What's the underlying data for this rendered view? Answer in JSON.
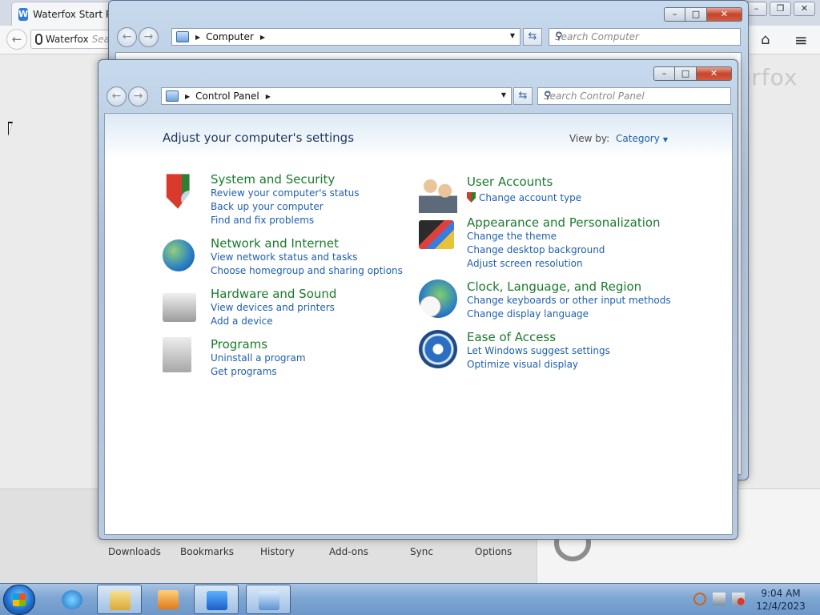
{
  "browser": {
    "tab_title": "Waterfox Start Pa",
    "tab_icon_letter": "W",
    "url_label": "Waterfox",
    "url_placeholder": "Sea",
    "watermark": "erfox",
    "footer": [
      "Downloads",
      "Bookmarks",
      "History",
      "Add-ons",
      "Sync",
      "Options"
    ]
  },
  "computer_window": {
    "breadcrumb": "Computer",
    "search_placeholder": "Search Computer"
  },
  "control_panel": {
    "breadcrumb": "Control Panel",
    "search_placeholder": "Search Control Panel",
    "heading": "Adjust your computer's settings",
    "view_by_label": "View by:",
    "view_by_value": "Category",
    "categories": [
      {
        "title": "System and Security",
        "icon": "shield-icon",
        "links": [
          "Review your computer's status",
          "Back up your computer",
          "Find and fix problems"
        ]
      },
      {
        "title": "Network and Internet",
        "icon": "network-globe-icon",
        "links": [
          "View network status and tasks",
          "Choose homegroup and sharing options"
        ]
      },
      {
        "title": "Hardware and Sound",
        "icon": "printer-icon",
        "links": [
          "View devices and printers",
          "Add a device"
        ]
      },
      {
        "title": "Programs",
        "icon": "programs-box-icon",
        "links": [
          "Uninstall a program",
          "Get programs"
        ]
      },
      {
        "title": "User Accounts",
        "icon": "users-icon",
        "links": [
          "Change account type"
        ]
      },
      {
        "title": "Appearance and Personalization",
        "icon": "personalization-icon",
        "links": [
          "Change the theme",
          "Change desktop background",
          "Adjust screen resolution"
        ]
      },
      {
        "title": "Clock, Language, and Region",
        "icon": "clock-globe-icon",
        "links": [
          "Change keyboards or other input methods",
          "Change display language"
        ]
      },
      {
        "title": "Ease of Access",
        "icon": "ease-of-access-icon",
        "links": [
          "Let Windows suggest settings",
          "Optimize visual display"
        ]
      }
    ]
  },
  "taskbar": {
    "time": "9:04 AM",
    "date": "12/4/2023",
    "items": [
      "internet-explorer-icon",
      "file-explorer-icon",
      "media-player-icon",
      "waterfox-icon",
      "control-panel-icon"
    ]
  }
}
